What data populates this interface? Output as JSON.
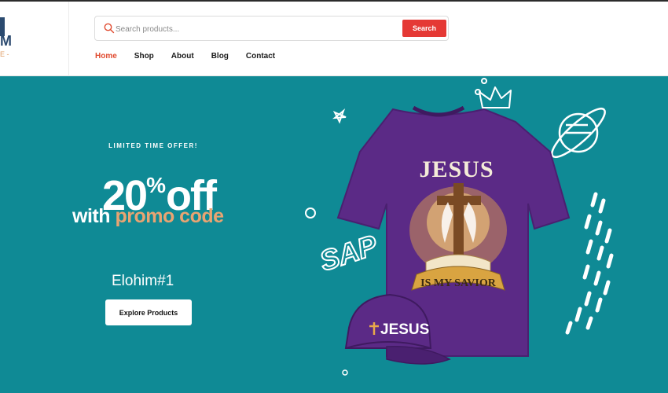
{
  "brand": {
    "logo_letter": "M",
    "logo_sub": "E -"
  },
  "search": {
    "placeholder": "Search products...",
    "button_label": "Search"
  },
  "nav": {
    "items": [
      "Home",
      "Shop",
      "About",
      "Blog",
      "Contact"
    ],
    "active": "Home"
  },
  "hero": {
    "offer_label": "LIMITED TIME OFFER!",
    "discount_number": "20",
    "discount_symbol": "%",
    "discount_word": "off",
    "promo_prefix": "with",
    "promo_highlight": "promo code",
    "promo_code": "Elohim#1",
    "cta_label": "Explore Products"
  },
  "product": {
    "shirt_top_text": "JESUS",
    "shirt_banner_text": "IS MY SAVIOR",
    "cap_text": "JESUS",
    "doodle_text": "SAP"
  },
  "colors": {
    "hero_bg": "#0f8a95",
    "accent_red": "#e53935",
    "nav_active": "#e04a2f",
    "promo_highlight": "#e9a472",
    "shirt": "#5b2a86"
  },
  "icons": [
    "search-icon",
    "crown-doodle-icon",
    "planet-doodle-icon",
    "star-doodle-icon",
    "cross-icon"
  ]
}
